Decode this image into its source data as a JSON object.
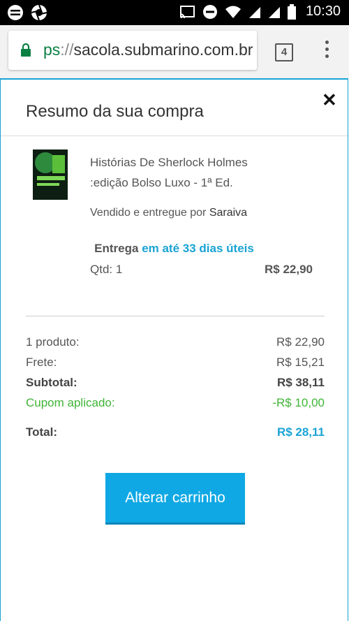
{
  "status_bar": {
    "time": "10:30"
  },
  "browser": {
    "url_scheme": "ps",
    "url_sep": "://",
    "url_host": "sacola.submarino.com.br",
    "tab_count": "4"
  },
  "modal": {
    "title": "Resumo da sua compra",
    "close": "✕"
  },
  "product": {
    "title_line1": "Histórias De Sherlock Holmes",
    "title_line2": ":edição Bolso Luxo - 1ª Ed.",
    "seller_prefix": "Vendido e entregue por",
    "seller_name": "Saraiva",
    "delivery_prefix": "Entrega",
    "delivery_time": "em até 33 dias úteis",
    "qty": "Qtd: 1",
    "price": "R$ 22,90"
  },
  "summary": {
    "products_label": "1 produto:",
    "products_value": "R$ 22,90",
    "shipping_label": "Frete:",
    "shipping_value": "R$ 15,21",
    "subtotal_label": "Subtotal:",
    "subtotal_value": "R$ 38,11",
    "coupon_label": "Cupom aplicado:",
    "coupon_value": "-R$ 10,00",
    "total_label": "Total:",
    "total_value": "R$ 28,11"
  },
  "actions": {
    "change_cart": "Alterar carrinho"
  },
  "colors": {
    "accent": "#1aa3d4",
    "button": "#0fa8e4",
    "coupon": "#3fb435"
  }
}
